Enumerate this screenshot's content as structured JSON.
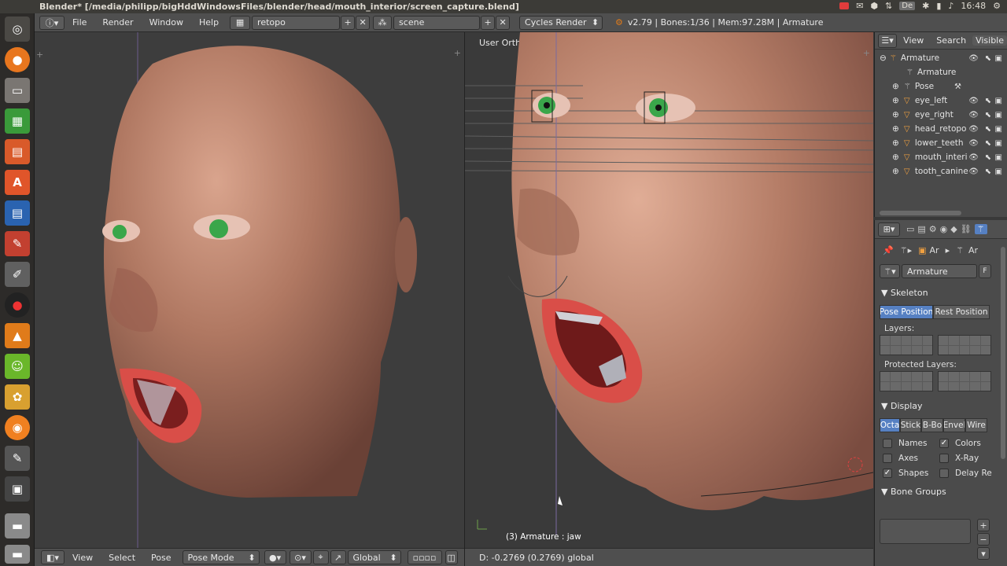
{
  "window": {
    "title": "Blender* [/media/philipp/bigHddWindowsFiles/blender/head/mouth_interior/screen_capture.blend]",
    "time": "16:48",
    "tray_de": "De"
  },
  "header": {
    "menus": [
      "File",
      "Render",
      "Window",
      "Help"
    ],
    "screen_layout": "retopo",
    "scene": "scene",
    "engine": "Cycles Render",
    "stats": "v2.79 | Bones:1/36 | Mem:97.28M | Armature"
  },
  "viewport_right": {
    "view_label": "User Ortho",
    "object_info": "(3) Armature : jaw",
    "status": "D: -0.2769 (0.2769) global"
  },
  "viewport_left_footer": {
    "view": "View",
    "select": "Select",
    "pose": "Pose",
    "mode": "Pose Mode",
    "orientation": "Global"
  },
  "outliner": {
    "tabs": [
      "View",
      "Search",
      "Visible"
    ],
    "items": [
      {
        "name": "Armature",
        "level": 0
      },
      {
        "name": "Armature",
        "level": 1
      },
      {
        "name": "Pose",
        "level": 1
      },
      {
        "name": "eye_left",
        "level": 1
      },
      {
        "name": "eye_right",
        "level": 1
      },
      {
        "name": "head_retopo",
        "level": 1
      },
      {
        "name": "lower_teeth",
        "level": 1
      },
      {
        "name": "mouth_interi",
        "level": 1
      },
      {
        "name": "tooth_canine",
        "level": 1
      }
    ]
  },
  "properties": {
    "breadcrumb": [
      "Ar",
      "Ar"
    ],
    "object_name": "Armature",
    "fake_user": "F",
    "skeleton": {
      "title": "Skeleton",
      "pose_position": "Pose Position",
      "rest_position": "Rest Position",
      "layers_label": "Layers:",
      "protected_label": "Protected Layers:"
    },
    "display": {
      "title": "Display",
      "buttons": [
        "Octa",
        "Stick",
        "B-Bo",
        "Envel",
        "Wire"
      ],
      "checks": [
        {
          "label": "Names",
          "checked": false
        },
        {
          "label": "Colors",
          "checked": true
        },
        {
          "label": "Axes",
          "checked": false
        },
        {
          "label": "X-Ray",
          "checked": false
        },
        {
          "label": "Shapes",
          "checked": true
        },
        {
          "label": "Delay Re",
          "checked": false
        }
      ]
    },
    "bone_groups": {
      "title": "Bone Groups"
    }
  },
  "colors": {
    "accent": "#5680c2",
    "skin": "#b47c66",
    "lip": "#d9534f",
    "eye": "#3aa64a"
  }
}
